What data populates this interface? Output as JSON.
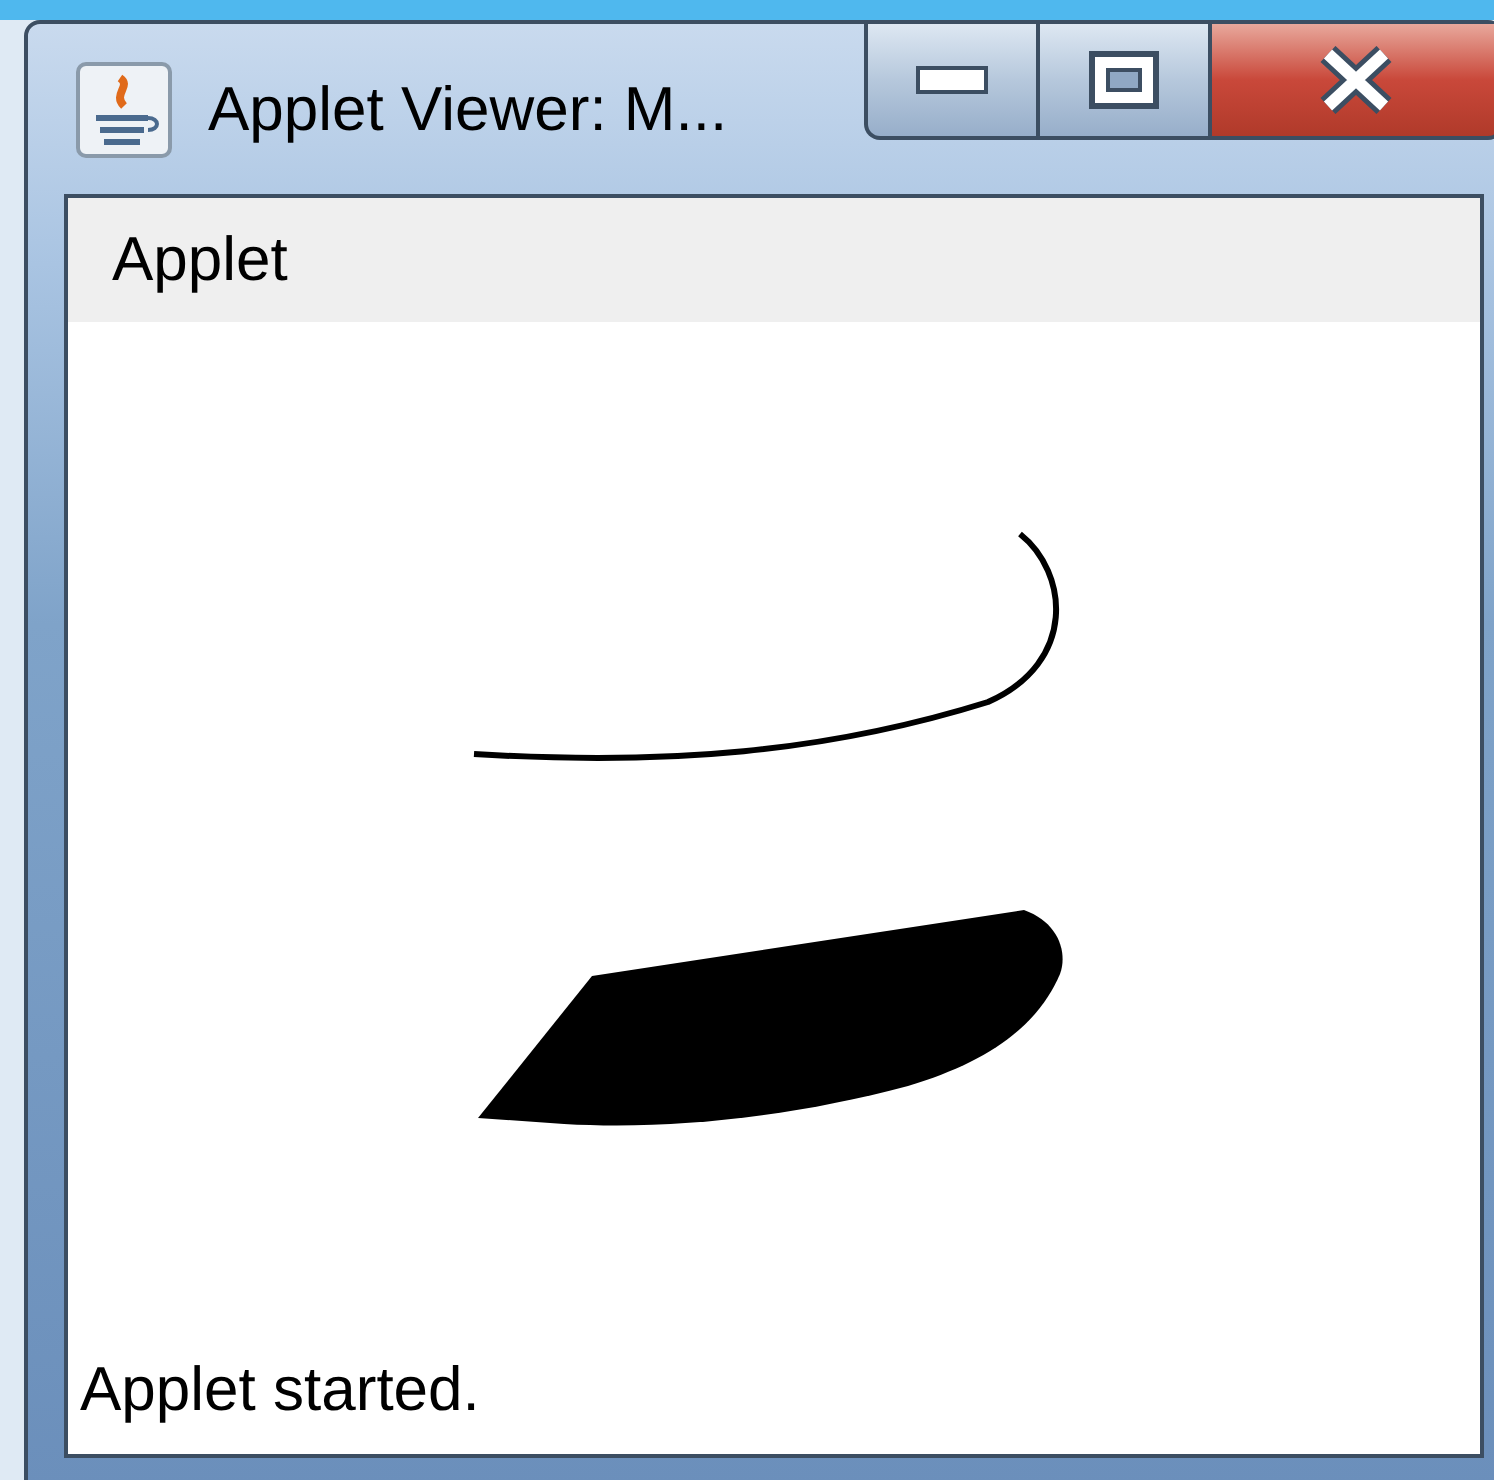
{
  "window": {
    "title": "Applet Viewer: M..."
  },
  "menu": [
    {
      "label": "Applet"
    }
  ],
  "status_bar": {
    "text": "Applet started."
  }
}
